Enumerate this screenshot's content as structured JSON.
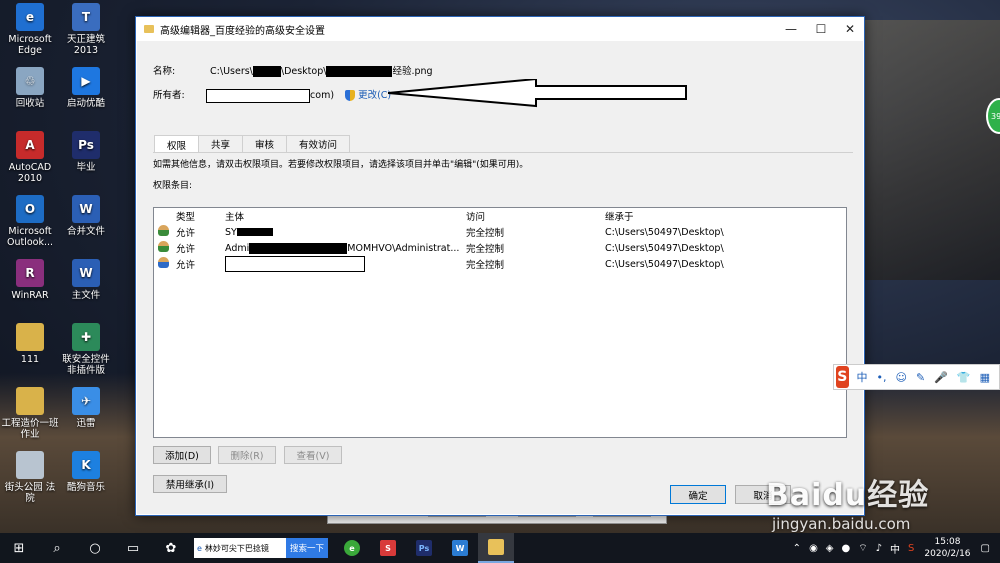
{
  "desktop_icons": [
    {
      "label": "Microsoft\nEdge",
      "icon": "edge-icon",
      "color": "#1f6fd1",
      "glyph": "e"
    },
    {
      "label": "天正建筑\n2013",
      "icon": "tangent-icon",
      "color": "#3a6dbf",
      "glyph": "T"
    },
    {
      "label": "回收站",
      "icon": "recycle-bin-icon",
      "color": "#8aa6c2",
      "glyph": "♲"
    },
    {
      "label": "启动优酷",
      "icon": "youku-icon",
      "color": "#1e77e0",
      "glyph": "▶"
    },
    {
      "label": "AutoCAD\n2010",
      "icon": "autocad-icon",
      "color": "#c62b2b",
      "glyph": "A"
    },
    {
      "label": "毕业",
      "icon": "photoshop-file-icon",
      "color": "#1f2d6b",
      "glyph": "Ps"
    },
    {
      "label": "Microsoft\nOutlook...",
      "icon": "outlook-icon",
      "color": "#1d6cc4",
      "glyph": "O"
    },
    {
      "label": "合并文件",
      "icon": "word-file-icon",
      "color": "#2b5fb5",
      "glyph": "W"
    },
    {
      "label": "WinRAR",
      "icon": "winrar-icon",
      "color": "#8a2f7d",
      "glyph": "R"
    },
    {
      "label": "主文件",
      "icon": "word-file-icon",
      "color": "#2b5fb5",
      "glyph": "W"
    },
    {
      "label": "111",
      "icon": "folder-icon",
      "color": "#d9b24a",
      "glyph": ""
    },
    {
      "label": "联安全控件\n非插件版",
      "icon": "security-control-icon",
      "color": "#2c8a5a",
      "glyph": "✚"
    },
    {
      "label": "工程造价一班\n作业",
      "icon": "folder-icon",
      "color": "#d9b24a",
      "glyph": ""
    },
    {
      "label": "迅雷",
      "icon": "thunder-icon",
      "color": "#3a8ee6",
      "glyph": "✈"
    },
    {
      "label": "街头公园 法\n院",
      "icon": "file-icon",
      "color": "#b8c4d0",
      "glyph": ""
    },
    {
      "label": "酷狗音乐",
      "icon": "kugou-icon",
      "color": "#1d80e0",
      "glyph": "K"
    }
  ],
  "dialog": {
    "title": "高级编辑器_百度经验的高级安全设置",
    "name_label": "名称:",
    "name_prefix": "C:\\Users\\",
    "name_mid": "\\Desktop\\",
    "name_suffix": "经验.png",
    "owner_label": "所有者:",
    "owner_suffix": "com)",
    "change_link": "更改(C)",
    "tabs": [
      "权限",
      "共享",
      "审核",
      "有效访问"
    ],
    "info_text": "如需其他信息，请双击权限项目。若要修改权限项目，请选择该项目并单击\"编辑\"(如果可用)。",
    "entries_label": "权限条目:",
    "columns": [
      "类型",
      "主体",
      "访问",
      "继承于"
    ],
    "rows": [
      {
        "icon": "users-group-icon",
        "type": "允许",
        "principal_prefix": "SY",
        "principal_suffix": "",
        "access": "完全控制",
        "inherit": "C:\\Users\\50497\\Desktop\\"
      },
      {
        "icon": "users-group-icon",
        "type": "允许",
        "principal_prefix": "Admi",
        "principal_suffix": "MOMHVO\\Administrat...",
        "access": "完全控制",
        "inherit": "C:\\Users\\50497\\Desktop\\"
      },
      {
        "icon": "user-icon",
        "type": "允许",
        "principal_prefix": "",
        "principal_suffix": "",
        "access": "完全控制",
        "inherit": "C:\\Users\\50497\\Desktop\\"
      }
    ],
    "buttons": {
      "add": "添加(D)",
      "remove": "删除(R)",
      "view": "查看(V)",
      "disable_inherit": "禁用继承(I)",
      "ok": "确定",
      "cancel": "取消"
    }
  },
  "ime": {
    "lang": "中",
    "punct": "•,",
    "emoji": "☺",
    "skin": "✎",
    "voice": "🎤",
    "menu": "👕",
    "grid": "▦"
  },
  "green_badge": "39",
  "taskbar": {
    "search_text": "林妙可尖下巴捻镜",
    "search_button": "搜索一下",
    "time": "15:08",
    "date": "2020/2/16"
  },
  "watermark": {
    "main": "Baidu经验",
    "url": "jingyan.baidu.com"
  }
}
